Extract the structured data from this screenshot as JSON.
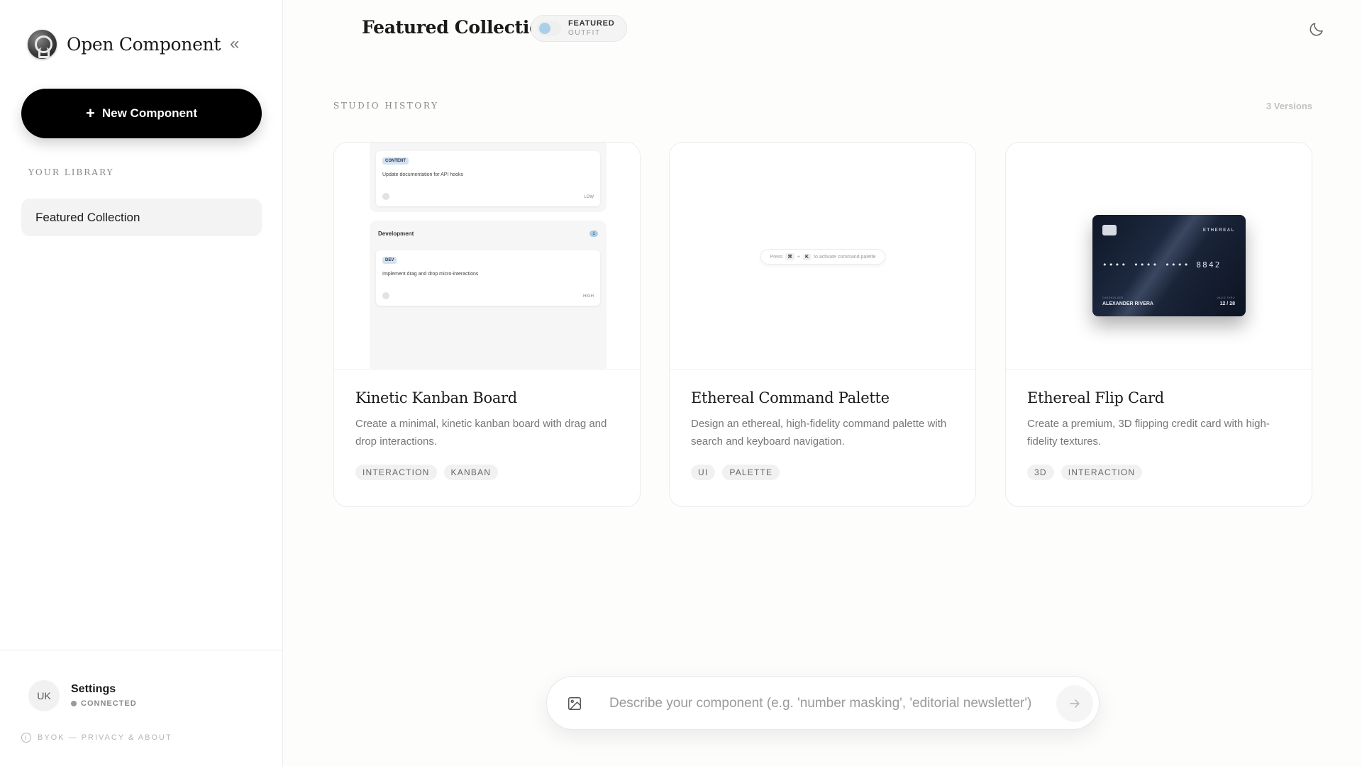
{
  "sidebar": {
    "brand": "Open Component",
    "collapse_glyph": "«",
    "new_button": "New Component",
    "new_button_plus": "+",
    "library_label": "YOUR LIBRARY",
    "library_items": [
      {
        "label": "Featured Collection"
      }
    ],
    "footer": {
      "avatar": "UK",
      "title": "Settings",
      "status": "CONNECTED",
      "about_icon": "i",
      "about": "BYOK — PRIVACY & ABOUT"
    }
  },
  "header": {
    "title": "Featured Collection",
    "toggle": {
      "main": "FEATURED",
      "sub": "OUTFIT"
    }
  },
  "section": {
    "label": "STUDIO HISTORY",
    "count": "3 Versions"
  },
  "cards": [
    {
      "title": "Kinetic Kanban Board",
      "description": "Create a minimal, kinetic kanban board with drag and drop interactions.",
      "tags": [
        "INTERACTION",
        "KANBAN"
      ],
      "preview": {
        "card1_chip": "CONTENT",
        "card1_text": "Update documentation for API hooks",
        "card1_priority": "LOW",
        "column_title": "Development",
        "column_count": "1",
        "card2_chip": "DEV",
        "card2_text": "Implement drag and drop micro-interactions",
        "card2_priority": "HIGH"
      }
    },
    {
      "title": "Ethereal Command Palette",
      "description": "Design an ethereal, high-fidelity command palette with search and keyboard navigation.",
      "tags": [
        "UI",
        "PALETTE"
      ],
      "preview": {
        "press": "Press",
        "key1": "⌘",
        "plus": "+",
        "key2": "K",
        "hint": "to activate command palette"
      }
    },
    {
      "title": "Ethereal Flip Card",
      "description": "Create a premium, 3D flipping credit card with high-fidelity textures.",
      "tags": [
        "3D",
        "INTERACTION"
      ],
      "preview": {
        "brand": "ETHEREAL",
        "number": "•••• •••• •••• 8842",
        "holder_label": "CARDHOLDER",
        "holder": "ALEXANDER RIVERA",
        "valid_label": "VALID THRU",
        "valid": "12 / 28"
      }
    }
  ],
  "prompt": {
    "placeholder": "Describe your component (e.g. 'number masking', 'editorial newsletter')",
    "value": ""
  }
}
